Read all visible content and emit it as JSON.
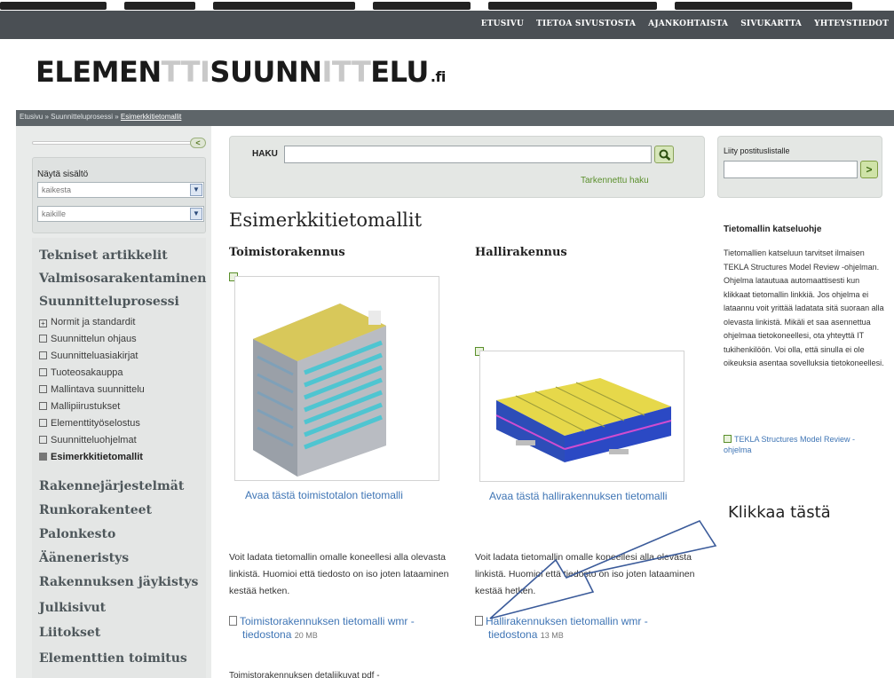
{
  "topnav": [
    "ETUSIVU",
    "TIETOA SIVUSTOSTA",
    "AJANKOHTAISTA",
    "SIVUKARTTA",
    "YHTEYSTIEDOT"
  ],
  "logo": {
    "part1": "ELEMEN",
    "part2": "TTI",
    "part3": "SUUNN",
    "part4": "ITT",
    "part5": "ELU",
    "tld": ".fi"
  },
  "breadcrumb": {
    "home": "Etusivu",
    "sep": "»",
    "section": "Suunnitteluprosessi",
    "current": "Esimerkkitietomallit"
  },
  "filters": {
    "label": "Näytä sisältö",
    "select1": "kaikesta",
    "select2": "kaikille"
  },
  "leftnav": {
    "main_top": [
      "Tekniset artikkelit",
      "Valmisosarakentaminen",
      "Suunnitteluprosessi"
    ],
    "sub": [
      "Normit ja standardit",
      "Suunnittelun ohjaus",
      "Suunnitteluasiakirjat",
      "Tuoteosakauppa",
      "Mallintava suunnittelu",
      "Mallipiirustukset",
      "Elementtityöselostus",
      "Suunnitteluohjelmat",
      "Esimerkkitietomallit"
    ],
    "main_bottom": [
      "Rakennejärjestelmät",
      "Runkorakenteet",
      "Palonkesto",
      "Ääneneristys",
      "Rakennuksen jäykistys",
      "Julkisivut",
      "Liitokset",
      "Elementtien toimitus"
    ]
  },
  "search": {
    "label": "HAKU",
    "value": "",
    "advanced": "Tarkennettu haku"
  },
  "mailing": {
    "label": "Liity postituslistalle",
    "button": ">"
  },
  "page_title": "Esimerkkitietomallit",
  "office": {
    "title": "Toimistorakennus",
    "link": "Avaa tästä toimistotalon tietomalli",
    "para": "Voit ladata tietomallin omalle koneellesi alla olevasta linkistä. Huomioi että tiedosto on iso joten lataaminen kestää hetken.",
    "file_link_1": "Toimistorakennuksen tietomalli wmr -",
    "file_link_2": "tiedostona",
    "file_size": "20 MB",
    "cut_text": "Toimistorakennuksen detaljikuvat pdf -"
  },
  "hall": {
    "title": "Hallirakennus",
    "link": "Avaa tästä hallirakennuksen tietomalli",
    "para": "Voit ladata tietomallin omalle koneellesi alla olevasta linkistä. Huomioi että tiedosto on iso joten lataaminen kestää hetken.",
    "file_link_1": "Hallirakennuksen tietomallin wmr -",
    "file_link_2": "tiedostona",
    "file_size": "13 MB"
  },
  "right": {
    "title": "Tietomallin katseluohje",
    "text": "Tietomallien katseluun tarvitset ilmaisen TEKLA Structures Model Review -ohjelman. Ohjelma latautuaa automaattisesti kun klikkaat tietomallin linkkiä. Jos ohjelma ei lataannu voit yrittää ladatata sitä suoraan alla olevasta linkistä. Mikäli et saa asennettua ohjelmaa tietokoneellesi, ota yhteyttä IT tukihenkilöön. Voi olla, että sinulla ei ole oikeuksia asentaa sovelluksia tietokoneellesi.",
    "link": "TEKLA Structures Model Review - ohjelma"
  },
  "callout": "Klikkaa tästä",
  "colors": {
    "topbar": "#4a4f54",
    "link": "#3f75b5",
    "green": "#5a8f2b"
  }
}
